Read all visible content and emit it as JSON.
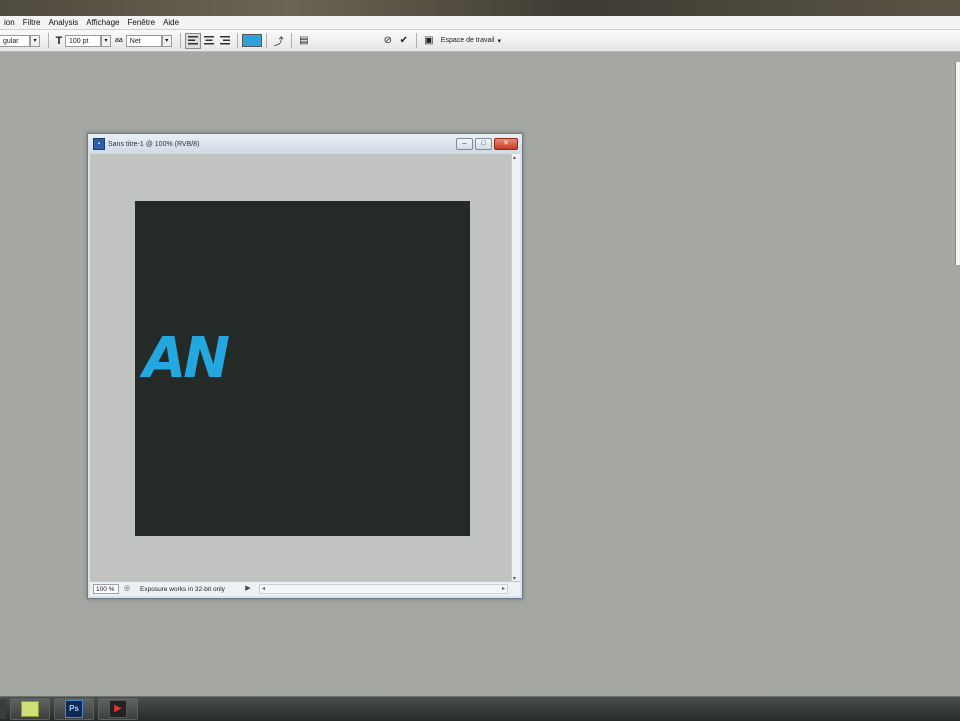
{
  "menubar": {
    "items": [
      "ion",
      "Filtre",
      "Analysis",
      "Affichage",
      "Fenêtre",
      "Aide"
    ]
  },
  "options": {
    "font_style": "gular",
    "font_size": "100 pt",
    "antialias": "Net",
    "antialias_icon": "aa",
    "text_color": "#2fa2d8",
    "workspace_label": "Espace de travail"
  },
  "document": {
    "title": "Sans titre-1 @ 100% (RVB/8)",
    "zoom": "100 %",
    "status_text": "Exposure works in 32-bit only",
    "canvas_color": "#242a28",
    "logo_text": "AN",
    "logo_color": "#22a8df"
  },
  "taskbar": {
    "ps_label": "Ps"
  }
}
